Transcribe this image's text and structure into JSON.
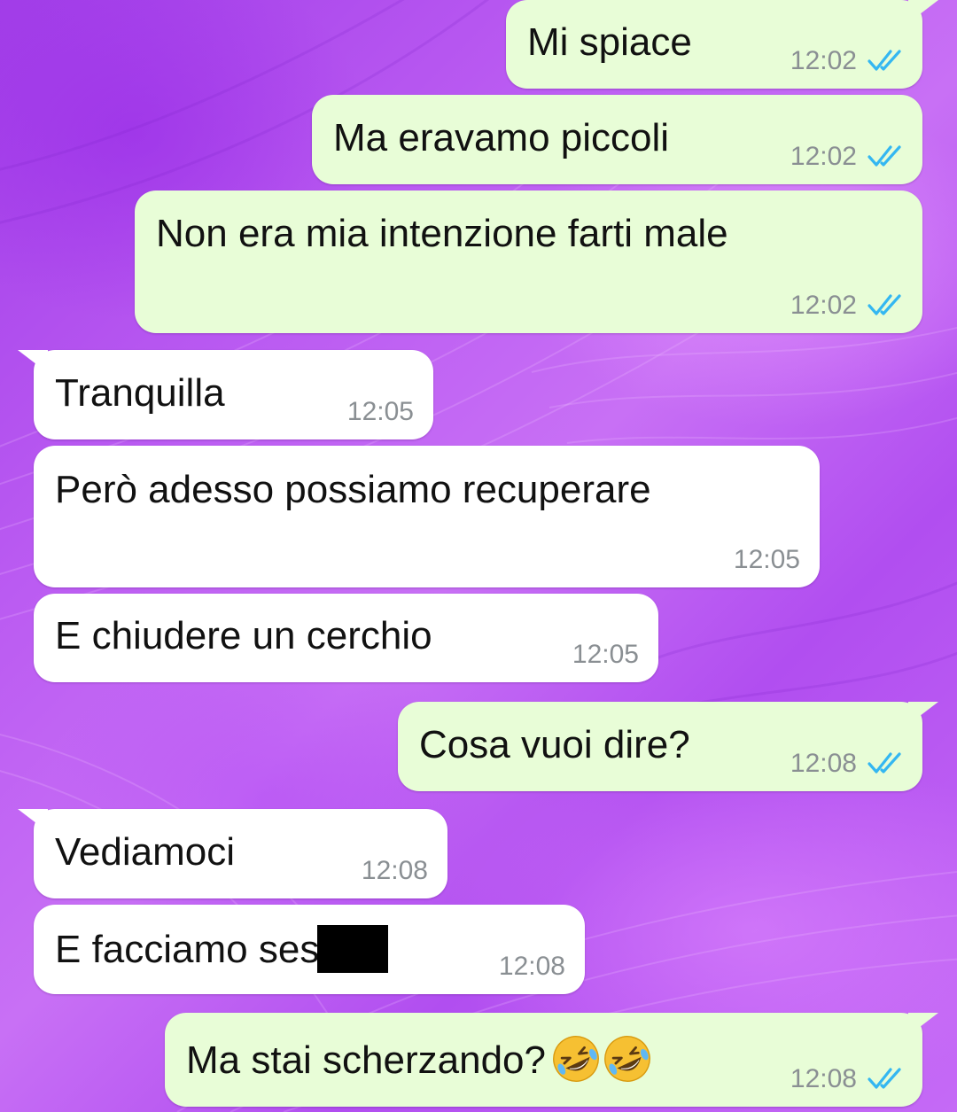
{
  "chat": {
    "messages": [
      {
        "text": "Mi spiace",
        "time": "12:02",
        "direction": "outgoing",
        "status": "read"
      },
      {
        "text": "Ma eravamo piccoli",
        "time": "12:02",
        "direction": "outgoing",
        "status": "read"
      },
      {
        "text": "Non era mia intenzione farti male",
        "time": "12:02",
        "direction": "outgoing",
        "status": "read"
      },
      {
        "text": "Tranquilla",
        "time": "12:05",
        "direction": "incoming"
      },
      {
        "text": "Però adesso possiamo recuperare",
        "time": "12:05",
        "direction": "incoming"
      },
      {
        "text": "E chiudere un cerchio",
        "time": "12:05",
        "direction": "incoming"
      },
      {
        "text": "Cosa vuoi dire?",
        "time": "12:08",
        "direction": "outgoing",
        "status": "read"
      },
      {
        "text": "Vediamoci",
        "time": "12:08",
        "direction": "incoming"
      },
      {
        "text": "E facciamo ses",
        "time": "12:08",
        "direction": "incoming",
        "redacted_suffix": true
      },
      {
        "text": "Ma stai scherzando?",
        "time": "12:08",
        "direction": "outgoing",
        "status": "read",
        "emojis": [
          "rolling-on-floor-laughing-emoji",
          "rolling-on-floor-laughing-emoji"
        ]
      }
    ]
  },
  "colors": {
    "outgoing_bubble": "#e8fdd7",
    "incoming_bubble": "#ffffff",
    "read_ticks": "#34b7f1",
    "timestamp": "#8a8f93",
    "wallpaper": "#b554f0"
  },
  "icons": {
    "read_status": "double-check-icon"
  }
}
